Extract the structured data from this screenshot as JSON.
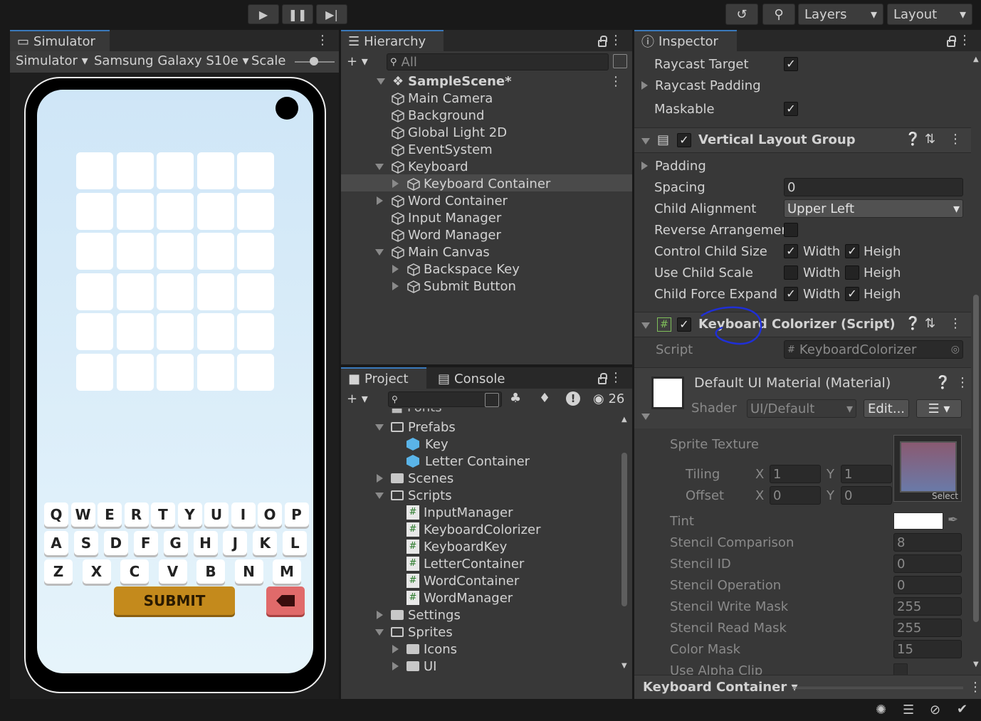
{
  "toolbar": {
    "play": "play-icon",
    "pause": "pause-icon",
    "step": "step-icon",
    "layers": "Layers",
    "layout": "Layout"
  },
  "simulator": {
    "tab": "Simulator",
    "mode": "Simulator",
    "device": "Samsung Galaxy S10e",
    "scale_label": "Scale",
    "keys_row1": [
      "Q",
      "W",
      "E",
      "R",
      "T",
      "Y",
      "U",
      "I",
      "O",
      "P"
    ],
    "keys_row2": [
      "A",
      "S",
      "D",
      "F",
      "G",
      "H",
      "J",
      "K",
      "L"
    ],
    "keys_row3": [
      "Z",
      "X",
      "C",
      "V",
      "B",
      "N",
      "M"
    ],
    "submit": "SUBMIT"
  },
  "hierarchy": {
    "tab": "Hierarchy",
    "search_placeholder": "All",
    "scene": "SampleScene*",
    "items": [
      "Main Camera",
      "Background",
      "Global Light 2D",
      "EventSystem",
      "Keyboard",
      "Keyboard Container",
      "Word Container",
      "Input Manager",
      "Word Manager",
      "Main Canvas",
      "Backspace Key",
      "Submit Button"
    ]
  },
  "project": {
    "tab": "Project",
    "console_tab": "Console",
    "count": "26",
    "partial_top": "Fonts",
    "items": [
      "Prefabs",
      "Key",
      "Letter Container",
      "Scenes",
      "Scripts",
      "InputManager",
      "KeyboardColorizer",
      "KeyboardKey",
      "LetterContainer",
      "WordContainer",
      "WordManager",
      "Settings",
      "Sprites",
      "Icons",
      "UI"
    ]
  },
  "inspector": {
    "tab": "Inspector",
    "raycast_target": "Raycast Target",
    "raycast_padding": "Raycast Padding",
    "maskable": "Maskable",
    "vlg_title": "Vertical Layout Group",
    "padding": "Padding",
    "spacing": "Spacing",
    "spacing_val": "0",
    "child_alignment": "Child Alignment",
    "child_alignment_val": "Upper Left",
    "reverse": "Reverse Arrangemer",
    "control_size": "Control Child Size",
    "use_scale": "Use Child Scale",
    "force_expand": "Child Force Expand",
    "width": "Width",
    "height": "Heigh",
    "script_title": "Keyboard Colorizer (Script)",
    "script_label": "Script",
    "script_val": "KeyboardColorizer",
    "material_title": "Default UI Material (Material)",
    "shader_label": "Shader",
    "shader_val": "UI/Default",
    "edit": "Edit...",
    "sprite_texture": "Sprite Texture",
    "tiling": "Tiling",
    "offset": "Offset",
    "x": "X",
    "y": "Y",
    "tiling_x": "1",
    "tiling_y": "1",
    "offset_x": "0",
    "offset_y": "0",
    "select": "Select",
    "tint": "Tint",
    "stencil_comp": "Stencil Comparison",
    "stencil_comp_val": "8",
    "stencil_id": "Stencil ID",
    "stencil_id_val": "0",
    "stencil_op": "Stencil Operation",
    "stencil_op_val": "0",
    "write_mask": "Stencil Write Mask",
    "write_mask_val": "255",
    "read_mask": "Stencil Read Mask",
    "read_mask_val": "255",
    "color_mask": "Color Mask",
    "color_mask_val": "15",
    "alpha_clip": "Use Alpha Clip",
    "footer": "Keyboard Container"
  },
  "colors": {
    "accent": "#3a79bb",
    "submit": "#c48a1c",
    "backspace": "#e06a6a",
    "annotation": "#1f2fd6"
  }
}
